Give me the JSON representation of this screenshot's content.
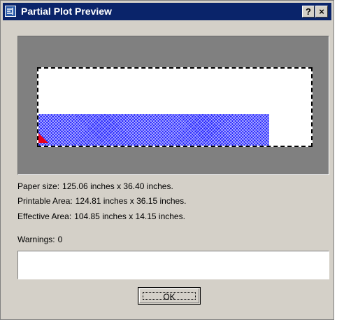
{
  "window": {
    "title": "Partial Plot Preview",
    "help_label": "?",
    "close_label": "×"
  },
  "info": {
    "paper_size": {
      "label": "Paper size:",
      "value": "125.06 inches x 36.40 inches."
    },
    "printable_area": {
      "label": "Printable Area:",
      "value": "124.81 inches x 36.15 inches."
    },
    "effective_area": {
      "label": "Effective Area:",
      "value": "104.85 inches x 14.15 inches."
    },
    "warnings": {
      "label": "Warnings:",
      "value": "0"
    }
  },
  "buttons": {
    "ok": "OK"
  },
  "colors": {
    "titlebar": "#0a246a",
    "dialog": "#d4d0c8",
    "preview_background": "#808080",
    "effective_area": "#2020ff",
    "origin_marker": "#e8001c"
  },
  "icons": {
    "title": "dialog-app-icon",
    "origin": "plot-origin-marker-icon"
  }
}
